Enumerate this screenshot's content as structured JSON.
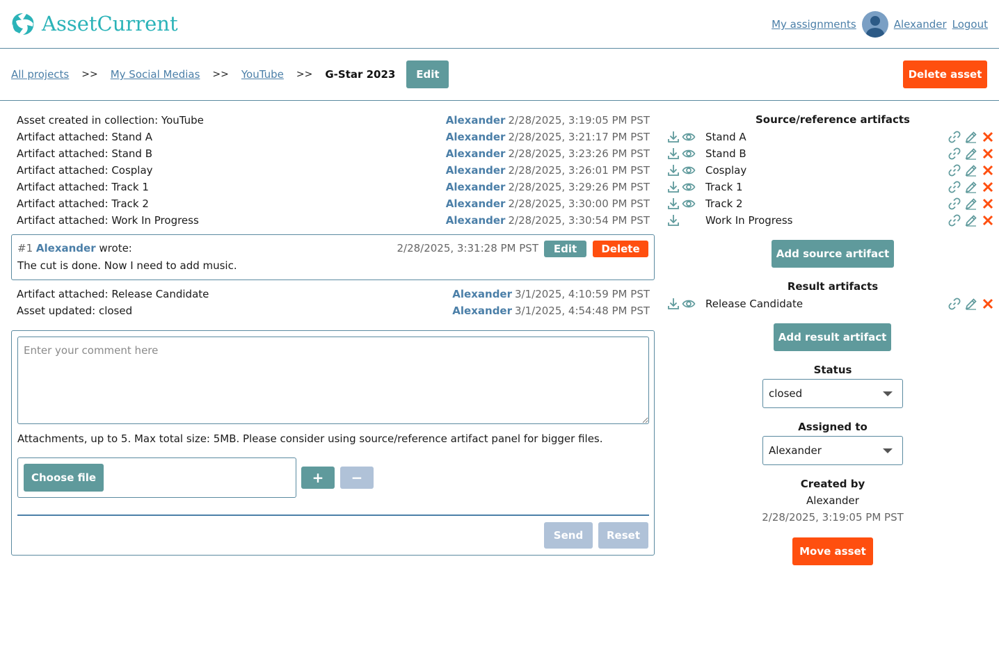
{
  "header": {
    "app_name": "AssetCurrent",
    "my_assignments": "My assignments",
    "user_name": "Alexander",
    "logout": "Logout"
  },
  "breadcrumb": {
    "items": [
      "All projects",
      "My Social Medias",
      "YouTube"
    ],
    "separator": ">>",
    "current": "G-Star 2023",
    "edit_label": "Edit",
    "delete_asset_label": "Delete asset"
  },
  "log": [
    {
      "text": "Asset created in collection: YouTube",
      "who": "Alexander",
      "when": "2/28/2025, 3:19:05 PM PST"
    },
    {
      "text": "Artifact attached: Stand A",
      "who": "Alexander",
      "when": "2/28/2025, 3:21:17 PM PST"
    },
    {
      "text": "Artifact attached: Stand B",
      "who": "Alexander",
      "when": "2/28/2025, 3:23:26 PM PST"
    },
    {
      "text": "Artifact attached: Cosplay",
      "who": "Alexander",
      "when": "2/28/2025, 3:26:01 PM PST"
    },
    {
      "text": "Artifact attached: Track 1",
      "who": "Alexander",
      "when": "2/28/2025, 3:29:26 PM PST"
    },
    {
      "text": "Artifact attached: Track 2",
      "who": "Alexander",
      "when": "2/28/2025, 3:30:00 PM PST"
    },
    {
      "text": "Artifact attached: Work In Progress",
      "who": "Alexander",
      "when": "2/28/2025, 3:30:54 PM PST"
    }
  ],
  "comment": {
    "number": "#1",
    "who": "Alexander",
    "wrote": "wrote:",
    "when": "2/28/2025, 3:31:28 PM PST",
    "text": "The cut is done. Now I need to add music.",
    "edit_label": "Edit",
    "delete_label": "Delete"
  },
  "log2": [
    {
      "text": "Artifact attached: Release Candidate",
      "who": "Alexander",
      "when": "3/1/2025, 4:10:59 PM PST"
    },
    {
      "text": "Asset updated: closed",
      "who": "Alexander",
      "when": "3/1/2025, 4:54:48 PM PST"
    }
  ],
  "form": {
    "placeholder": "Enter your comment here",
    "attachments_note": "Attachments, up to 5. Max total size: 5MB. Please consider using source/reference artifact panel for bigger files.",
    "choose_file": "Choose file",
    "plus": "+",
    "minus": "−",
    "send": "Send",
    "reset": "Reset"
  },
  "panel": {
    "source_title": "Source/reference artifacts",
    "source_items": [
      {
        "name": "Stand A",
        "viewable": true
      },
      {
        "name": "Stand B",
        "viewable": true
      },
      {
        "name": "Cosplay",
        "viewable": true
      },
      {
        "name": "Track 1",
        "viewable": true
      },
      {
        "name": "Track 2",
        "viewable": true
      },
      {
        "name": "Work In Progress",
        "viewable": false
      }
    ],
    "add_source": "Add source artifact",
    "result_title": "Result artifacts",
    "result_items": [
      {
        "name": "Release Candidate",
        "viewable": true
      }
    ],
    "add_result": "Add result artifact",
    "status_label": "Status",
    "status_value": "closed",
    "assigned_label": "Assigned to",
    "assigned_value": "Alexander",
    "created_by_label": "Created by",
    "created_by_value": "Alexander",
    "created_at": "2/28/2025, 3:19:05 PM PST",
    "move_asset": "Move asset"
  },
  "colors": {
    "teal": "#5f9a9c",
    "orange": "#ff4f0f",
    "link": "#4b7fa8",
    "logo": "#2bb3b8",
    "disabled": "#b0c2d8"
  }
}
